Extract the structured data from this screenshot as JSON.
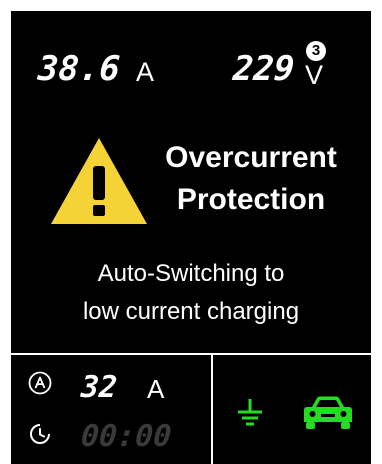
{
  "readings": {
    "current_value": "38.6",
    "current_unit": "A",
    "voltage_value": "229",
    "voltage_unit": "V",
    "phase": "3"
  },
  "warning": {
    "icon": "warning-triangle-icon",
    "title_line1": "Overcurrent",
    "title_line2": "Protection",
    "message_line1": "Auto-Switching to",
    "message_line2": "low current charging"
  },
  "bottom": {
    "set_current_value": "32",
    "set_current_unit": "A",
    "timer": "00:00",
    "icons": [
      "amp-circle-icon",
      "clock-icon",
      "ground-icon",
      "car-icon"
    ]
  },
  "colors": {
    "background": "#000000",
    "text": "#ffffff",
    "warning": "#f5d337",
    "status_green": "#22dd22",
    "inactive": "#3a3a3a"
  }
}
